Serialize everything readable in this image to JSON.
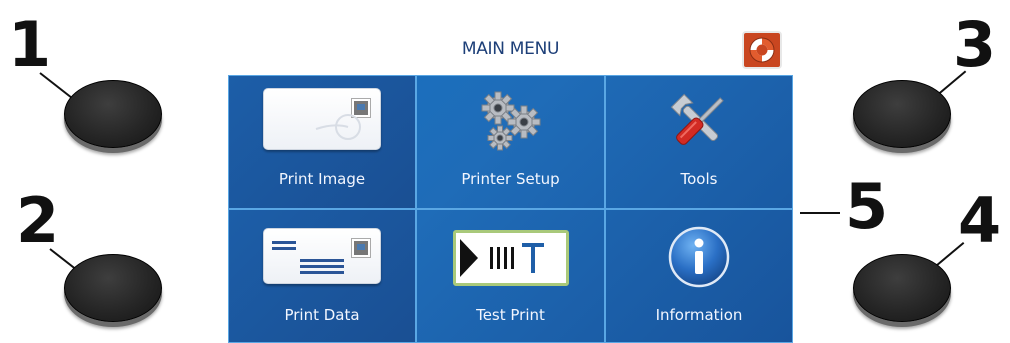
{
  "callouts": [
    "1",
    "2",
    "3",
    "4",
    "5"
  ],
  "screen": {
    "title": "MAIN MENU",
    "help_icon": "lifebuoy-help-icon",
    "tiles": [
      {
        "label": "Print Image",
        "icon": "print-image-card-icon"
      },
      {
        "label": "Printer Setup",
        "icon": "gears-icon"
      },
      {
        "label": "Tools",
        "icon": "screwdriver-wrench-icon"
      },
      {
        "label": "Print Data",
        "icon": "print-data-card-icon"
      },
      {
        "label": "Test Print",
        "icon": "test-print-icon"
      },
      {
        "label": "Information",
        "icon": "info-icon"
      }
    ]
  },
  "colors": {
    "tile_blue": "#1672c2",
    "help_orange": "#c94620",
    "title_blue": "#1d3f78"
  }
}
